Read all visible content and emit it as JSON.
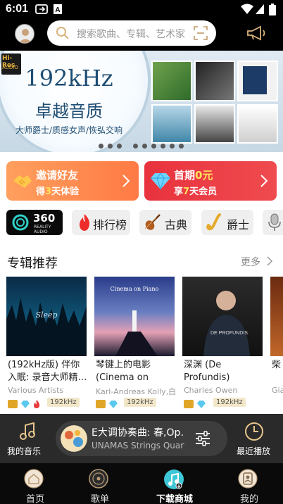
{
  "status_bar": {
    "time": "6:01"
  },
  "search": {
    "placeholder": "搜索歌曲、专辑、艺术家"
  },
  "banner": {
    "badge_line1": "Hi-Res",
    "badge_line2": "AUDIO",
    "title": "192kHz",
    "subtitle": "卓越音质",
    "tagline": "大师爵士/质感女声/恢弘交响",
    "page_count": 9,
    "active_page": 3
  },
  "promos": [
    {
      "line1": "邀请好友",
      "line2_pre": "得",
      "line2_hl": "3",
      "line2_post": "天体验",
      "color": "#ff9a4a"
    },
    {
      "line1_pre": "首期",
      "line1_hl": "0元",
      "line2_pre": "享",
      "line2_hl": "7",
      "line2_post": "天会员",
      "color": "#e83c45"
    }
  ],
  "chips": [
    {
      "label_big": "360",
      "label_small1": "REALITY",
      "label_small2": "AUDIO"
    },
    {
      "label": "排行榜"
    },
    {
      "label": "古典"
    },
    {
      "label": "爵士"
    }
  ],
  "section": {
    "title": "专辑推荐",
    "more": "更多"
  },
  "albums": [
    {
      "title": "(192kHz版) 伴你入眠: 录音大师精…",
      "artist": "Various Artists",
      "freq": "192kHz"
    },
    {
      "title": "琴键上的电影 (Cinema on Pian…",
      "artist": "Karl-Andreas Kolly,白…",
      "freq": "192kHz"
    },
    {
      "title": "深渊 (De Profundis)",
      "artist": "Charles Owen",
      "freq": "192kHz"
    },
    {
      "title": "柴",
      "artist": "Gia",
      "freq": ""
    }
  ],
  "player": {
    "my_music": "我的音乐",
    "recent": "最近播放",
    "song": "E大调协奏曲: 春,Op…",
    "artist": "UNAMAS Strings Quart…"
  },
  "nav": [
    {
      "label": "首页",
      "active": false
    },
    {
      "label": "歌单",
      "active": false
    },
    {
      "label": "下载商城",
      "active": true
    },
    {
      "label": "我的",
      "active": false
    }
  ]
}
